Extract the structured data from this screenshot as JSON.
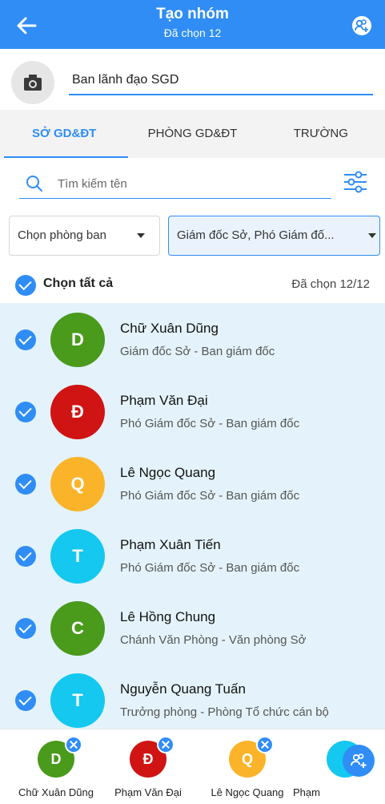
{
  "header": {
    "title": "Tạo nhóm",
    "subtitle": "Đã chọn 12",
    "back_icon": "arrow-left-icon",
    "add_group_icon": "group-add-icon",
    "color": "#2f8df5"
  },
  "group": {
    "camera_icon": "camera-icon",
    "name_value": "Ban lãnh đạo SGD"
  },
  "tabs": [
    {
      "label": "SỞ GD&ĐT",
      "active": true
    },
    {
      "label": "PHÒNG GD&ĐT",
      "active": false
    },
    {
      "label": "TRƯỜNG",
      "active": false
    }
  ],
  "search": {
    "placeholder": "Tìm kiếm tên",
    "filter_icon": "filter-sliders-icon"
  },
  "filters": {
    "department": "Chọn phòng ban",
    "position": "Giám đốc Sở, Phó Giám đố..."
  },
  "select_all": {
    "label": "Chọn tất cả",
    "count": "Đã chọn 12/12"
  },
  "members": [
    {
      "initial": "D",
      "name": "Chữ Xuân Dũng",
      "role": "Giám đốc Sở - Ban giám đốc",
      "color": "#4a9a1c"
    },
    {
      "initial": "Đ",
      "name": "Phạm Văn Đại",
      "role": "Phó Giám đốc Sở - Ban giám đốc",
      "color": "#d01414"
    },
    {
      "initial": "Q",
      "name": "Lê Ngọc Quang",
      "role": "Phó Giám đốc Sở - Ban giám đốc",
      "color": "#fbb42a"
    },
    {
      "initial": "T",
      "name": "Phạm Xuân Tiến",
      "role": "Phó Giám đốc Sở - Ban giám đốc",
      "color": "#14c8f0"
    },
    {
      "initial": "C",
      "name": "Lê Hồng Chung",
      "role": "Chánh Văn Phòng - Văn phòng Sở",
      "color": "#4a9a1c"
    },
    {
      "initial": "T",
      "name": "Nguyễn Quang Tuấn",
      "role": "Trưởng phòng - Phòng Tổ chức cán bộ",
      "color": "#14c8f0"
    }
  ],
  "selected_chips": [
    {
      "initial": "D",
      "name": "Chữ Xuân Dũng",
      "color": "#4a9a1c"
    },
    {
      "initial": "Đ",
      "name": "Phạm Văn Đại",
      "color": "#d01414"
    },
    {
      "initial": "Q",
      "name": "Lê Ngọc Quang",
      "color": "#fbb42a"
    },
    {
      "initial": "",
      "name": "Phạm",
      "color": "#14c8f0"
    }
  ],
  "fab_icon": "group-add-icon"
}
